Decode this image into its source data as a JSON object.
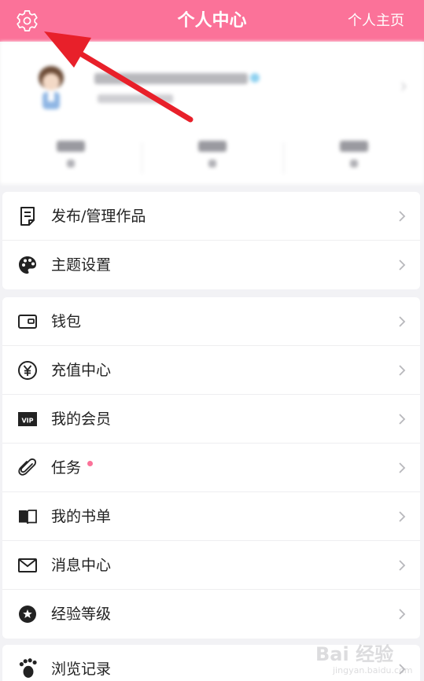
{
  "header": {
    "title": "个人中心",
    "home_link": "个人主页",
    "background": "#fb7299"
  },
  "profile": {
    "blurred": true
  },
  "menu_card_1": [
    {
      "label": "发布/管理作品",
      "icon": "document-icon"
    },
    {
      "label": "主题设置",
      "icon": "palette-icon"
    }
  ],
  "menu_card_2": [
    {
      "label": "钱包",
      "icon": "wallet-icon"
    },
    {
      "label": "充值中心",
      "icon": "yen-coin-icon"
    },
    {
      "label": "我的会员",
      "icon": "vip-icon"
    },
    {
      "label": "任务",
      "icon": "paperclip-icon",
      "badge": "dot"
    },
    {
      "label": "我的书单",
      "icon": "book-icon"
    },
    {
      "label": "消息中心",
      "icon": "mail-icon"
    },
    {
      "label": "经验等级",
      "icon": "star-circle-icon"
    }
  ],
  "menu_card_3": [
    {
      "label": "浏览记录",
      "icon": "footprint-icon"
    }
  ],
  "watermark": {
    "main": "Bai 经验",
    "sub": "jingyan.baidu.com"
  },
  "accent_color": "#fb7299",
  "annotation_color": "#e8202a"
}
